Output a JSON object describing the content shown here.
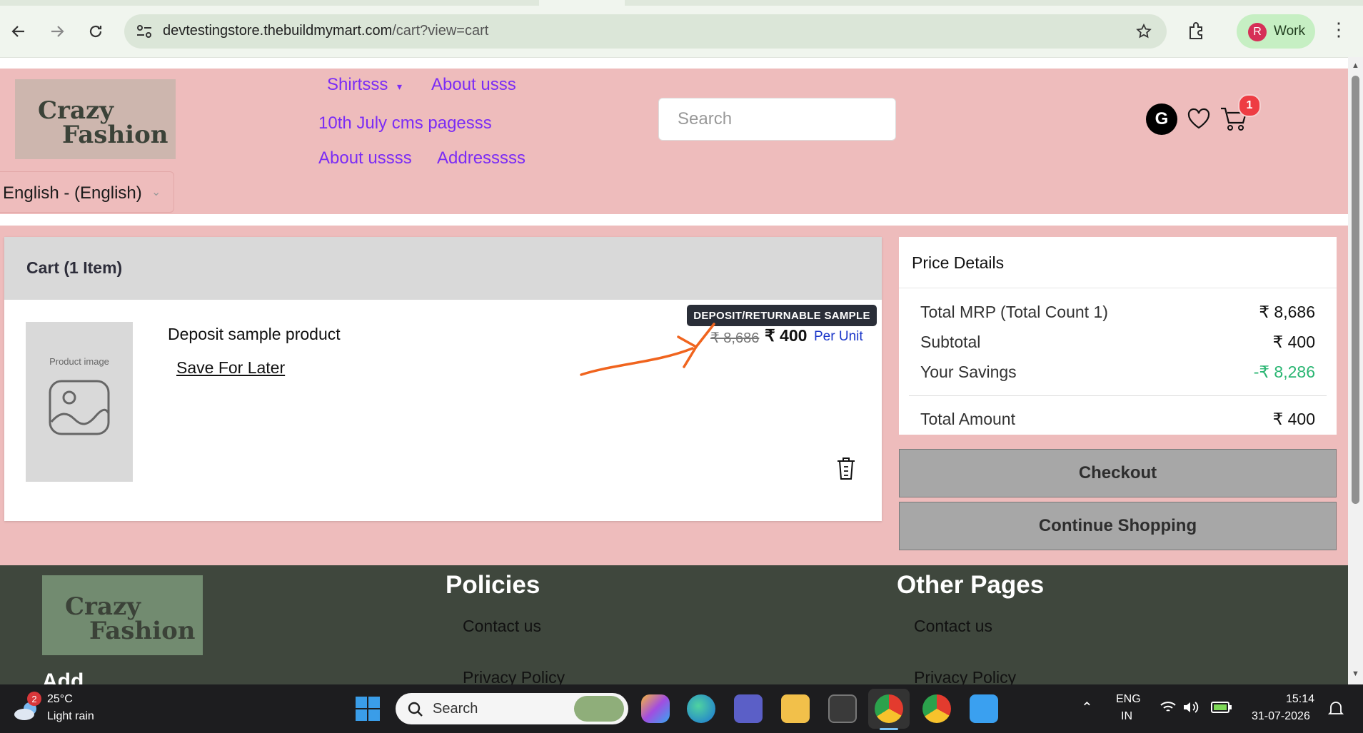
{
  "browser": {
    "url_domain": "devtestingstore.thebuildmymart.com",
    "url_path": "/cart?view=cart",
    "profile_initial": "R",
    "profile_label": "Work"
  },
  "header": {
    "logo_line1": "Crazy",
    "logo_line2": "Fashion",
    "nav": [
      "Shirtsss",
      "About usss",
      "10th July cms pagesss",
      "About ussss",
      "Addresssss"
    ],
    "search_placeholder": "Search",
    "language": "English - (English)",
    "user_initial": "G",
    "cart_count": "1"
  },
  "cart": {
    "title": "Cart (1 Item)",
    "thumbnail_label": "Product image",
    "product_name": "Deposit sample product",
    "save_for_later": "Save For Later",
    "badge": "DEPOSIT/RETURNABLE SAMPLE",
    "mrp": "₹ 8,686",
    "price": "₹ 400",
    "per_unit": "Per Unit"
  },
  "price_details": {
    "title": "Price Details",
    "rows": [
      {
        "label": "Total MRP (Total Count 1)",
        "value": "₹ 8,686"
      },
      {
        "label": "Subtotal",
        "value": "₹ 400"
      },
      {
        "label": "Your Savings",
        "value": "-₹ 8,286"
      }
    ],
    "total_label": "Total Amount",
    "total_value": "₹ 400"
  },
  "actions": {
    "checkout": "Checkout",
    "continue": "Continue Shopping"
  },
  "footer": {
    "logo_line1": "Crazy",
    "logo_line2": "Fashion",
    "policies_title": "Policies",
    "policies_links": [
      "Contact us",
      "Privacy Policy"
    ],
    "other_title": "Other Pages",
    "other_links": [
      "Contact us",
      "Privacy Policy"
    ],
    "address_peek": "Add"
  },
  "taskbar": {
    "weather_badge": "2",
    "temperature": "25°C",
    "weather": "Light rain",
    "search": "Search",
    "lang_line1": "ENG",
    "lang_line2": "IN",
    "time": "15:14",
    "date": "31-07-2026"
  },
  "colors": {
    "header_bg": "#eebcbc",
    "nav_link": "#7b2cf5",
    "savings": "#2bb673",
    "footer_bg": "#3f473d",
    "annotation": "#f0641e"
  }
}
